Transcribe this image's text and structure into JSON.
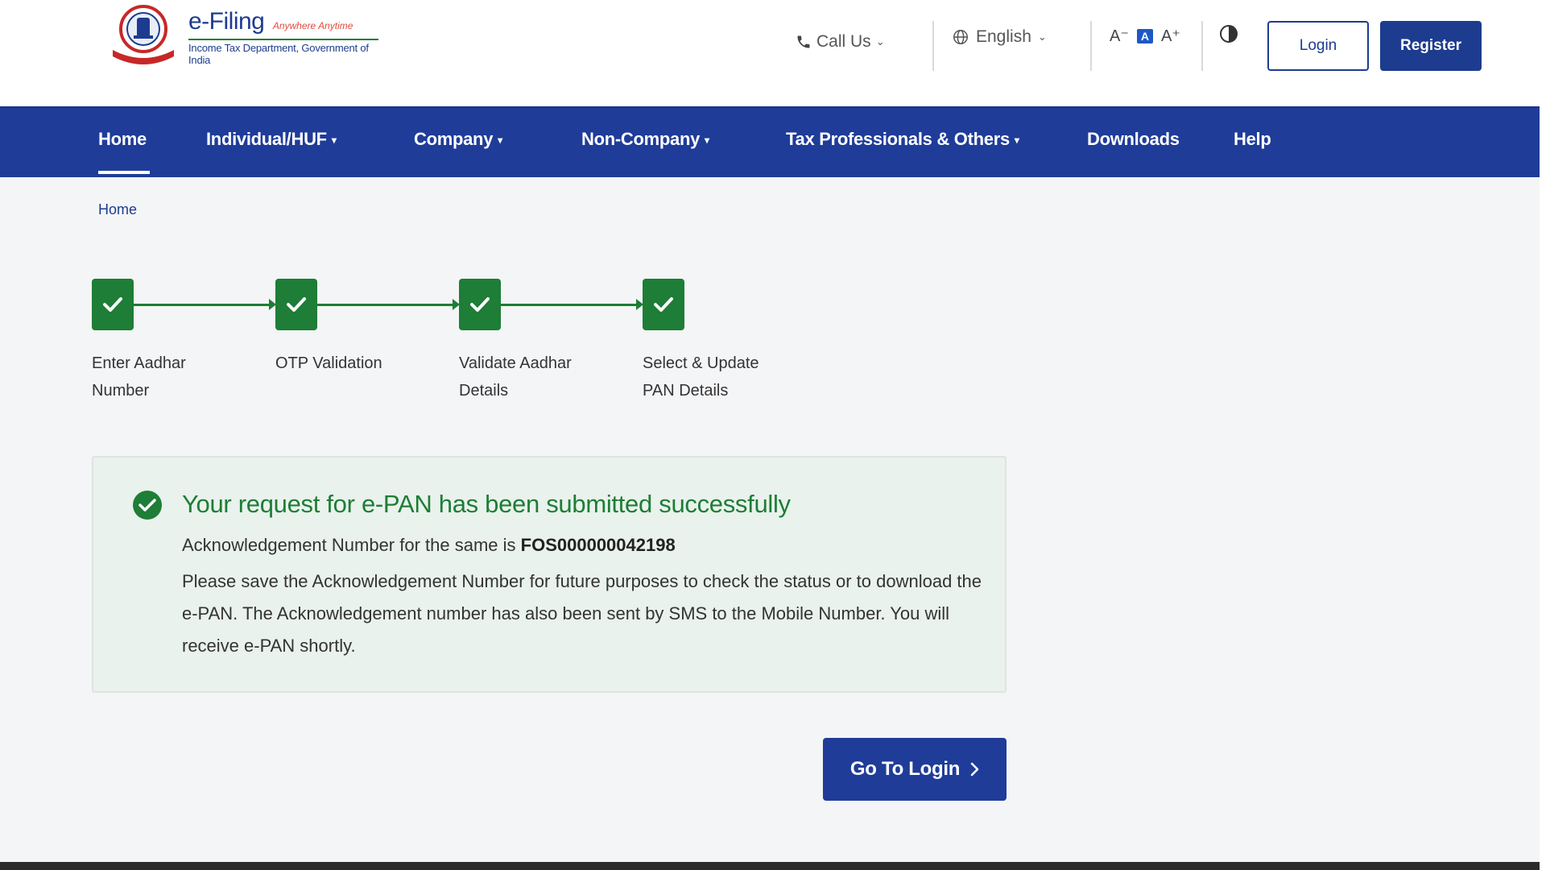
{
  "header": {
    "brand_main": "e-Filing",
    "brand_tagline": "Anywhere Anytime",
    "brand_sub": "Income Tax Department, Government of India",
    "call_us": "Call Us",
    "language": "English",
    "font_small": "A⁻",
    "font_default": "A",
    "font_large": "A⁺",
    "login": "Login",
    "register": "Register"
  },
  "nav": {
    "items": [
      {
        "label": "Home",
        "has_dropdown": false,
        "active": true
      },
      {
        "label": "Individual/HUF",
        "has_dropdown": true
      },
      {
        "label": "Company",
        "has_dropdown": true
      },
      {
        "label": "Non-Company",
        "has_dropdown": true
      },
      {
        "label": "Tax Professionals & Others",
        "has_dropdown": true
      },
      {
        "label": "Downloads",
        "has_dropdown": false
      },
      {
        "label": "Help",
        "has_dropdown": false
      }
    ]
  },
  "breadcrumb": "Home",
  "steps": [
    {
      "label": "Enter Aadhar Number",
      "status": "complete"
    },
    {
      "label": "OTP Validation",
      "status": "complete"
    },
    {
      "label": "Validate Aadhar Details",
      "status": "complete"
    },
    {
      "label": "Select & Update PAN Details",
      "status": "complete"
    }
  ],
  "success": {
    "title": "Your request for e-PAN has been submitted successfully",
    "ack_prefix": "Acknowledgement Number for the same is",
    "ack_number": "FOS000000042198",
    "message": "Please save the Acknowledgement Number for future purposes to check the status or to download the e-PAN. The Acknowledgement number has also been sent by SMS to the Mobile Number. You will receive e-PAN shortly."
  },
  "go_to_login": "Go To Login",
  "colors": {
    "brand_blue": "#1f3c99",
    "success_green": "#1e7d36",
    "card_bg": "#e9f2ec"
  }
}
